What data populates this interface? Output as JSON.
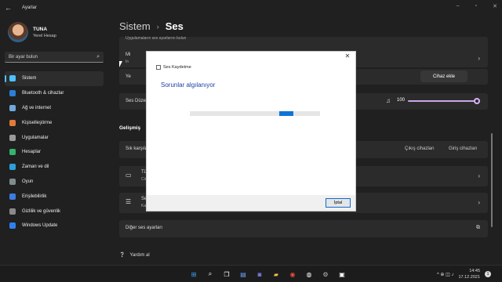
{
  "window": {
    "title": "Ayarlar",
    "back_glyph": "←",
    "min_glyph": "–",
    "max_glyph": "▫",
    "close_glyph": "✕"
  },
  "profile": {
    "name": "TUNA",
    "sub": "Yerel Hesap"
  },
  "search": {
    "placeholder": "Bir ayar bulun"
  },
  "nav": [
    {
      "label": "Sistem",
      "color": "#4cc2ff"
    },
    {
      "label": "Bluetooth & cihazlar",
      "color": "#2b7fd6"
    },
    {
      "label": "Ağ ve internet",
      "color": "#6fa8dc"
    },
    {
      "label": "Kişiselleştirme",
      "color": "#e07b39"
    },
    {
      "label": "Uygulamalar",
      "color": "#9b9b9b"
    },
    {
      "label": "Hesaplar",
      "color": "#33b56c"
    },
    {
      "label": "Zaman ve dil",
      "color": "#2c9fd9"
    },
    {
      "label": "Oyun",
      "color": "#7f8c8d"
    },
    {
      "label": "Erişilebilirlik",
      "color": "#3d7be0"
    },
    {
      "label": "Gizlilik ve güvenlik",
      "color": "#8a8a8a"
    },
    {
      "label": "Windows Update",
      "color": "#2f80ed"
    }
  ],
  "breadcrumb": {
    "parent": "Sistem",
    "current": "Ses",
    "sep": "›"
  },
  "main": {
    "top_text": "Uygulamaların ses ayarlarını bulun",
    "row_m": "Mi",
    "row_m_sub": "In",
    "row_ye": "Ye",
    "add_device": "Cihaz ekle",
    "volume_label": "Ses Düze",
    "volume_value": "100",
    "volume_level": 1.0,
    "advanced_title": "Gelişmiş",
    "sik_label": "Sık karşıla",
    "output_link": "Çıkış cihazları",
    "input_link": "Giriş cihazları",
    "tum_label": "Tü",
    "tum_sub": "Ciı",
    "se_label": "Se",
    "se_sub": "Ka",
    "other_settings": "Diğer ses ayarları",
    "help": "Yardım al"
  },
  "dialog": {
    "title": "Ses Kaydetme",
    "heading": "Sorunlar algılanıyor",
    "cancel": "İptal"
  },
  "taskbar": {
    "time": "14:45",
    "date": "17.12.2021",
    "tray_glyphs": "^ ⊕ ◫ ♪",
    "notif_count": "1"
  }
}
